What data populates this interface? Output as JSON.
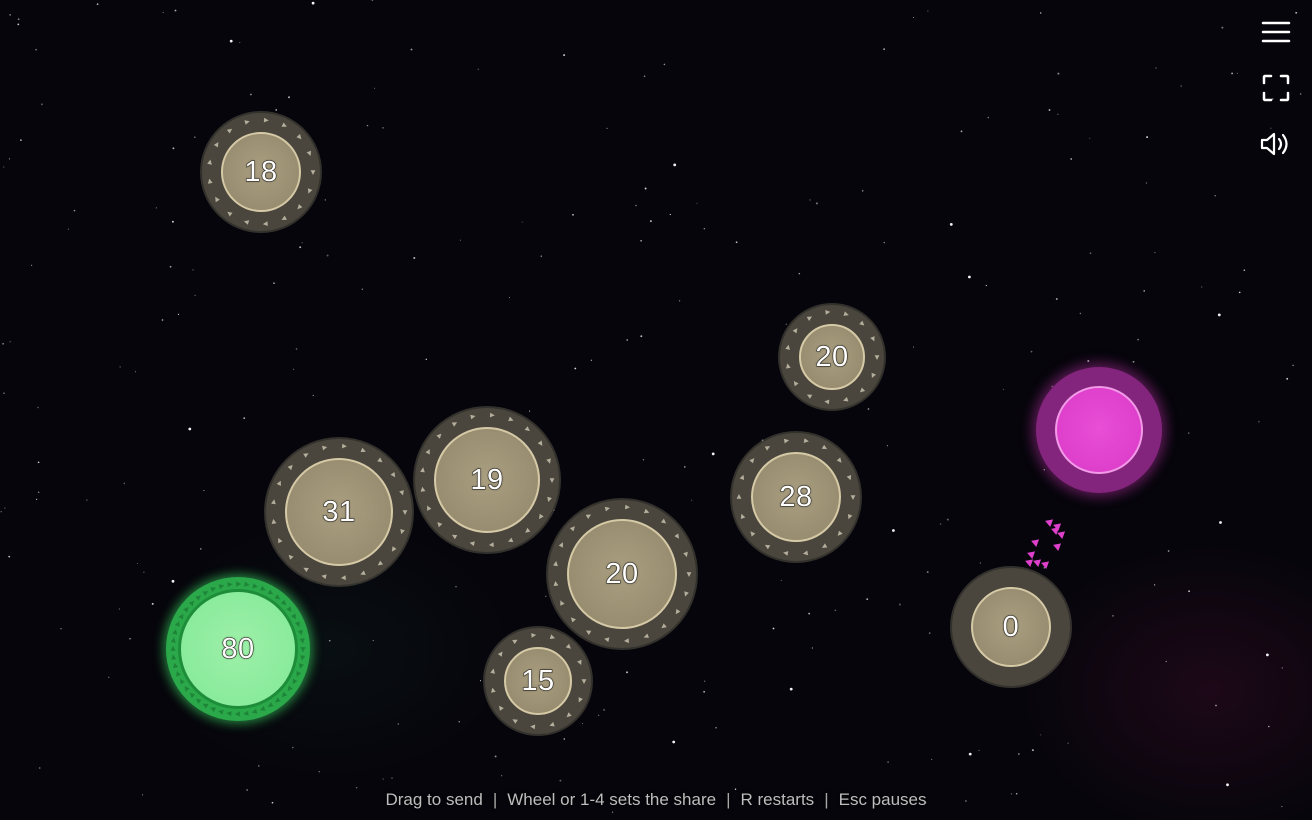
{
  "colors": {
    "player": "#8aeb9c",
    "enemy": "#de40cc",
    "neutral": "#988d70",
    "background": "#06050b"
  },
  "planets": [
    {
      "id": "p1",
      "owner": "neutral",
      "units": "18"
    },
    {
      "id": "p2",
      "owner": "neutral",
      "units": "20"
    },
    {
      "id": "p3",
      "owner": "neutral",
      "units": "31"
    },
    {
      "id": "p4",
      "owner": "neutral",
      "units": "19"
    },
    {
      "id": "p5",
      "owner": "neutral",
      "units": "28"
    },
    {
      "id": "p6",
      "owner": "neutral",
      "units": "20"
    },
    {
      "id": "p7",
      "owner": "player",
      "units": "80"
    },
    {
      "id": "p8",
      "owner": "neutral",
      "units": "15"
    },
    {
      "id": "p9",
      "owner": "neutral",
      "units": "0"
    },
    {
      "id": "p10",
      "owner": "enemy",
      "units": ""
    }
  ],
  "fleet": {
    "owner": "enemy",
    "ships": 10
  },
  "controls": {
    "menu_icon": "hamburger-menu-icon",
    "fullscreen_icon": "fullscreen-icon",
    "sound_icon": "speaker-icon"
  },
  "help": {
    "drag": "Drag to send",
    "wheel": "Wheel or 1-4 sets the share",
    "restart": "R restarts",
    "pause": "Esc pauses",
    "separator": "|"
  }
}
